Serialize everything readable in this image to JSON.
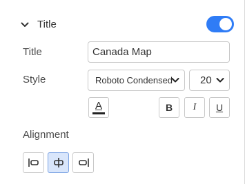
{
  "section": {
    "title": "Title",
    "enabled": true
  },
  "title_field": {
    "label": "Title",
    "value": "Canada Map"
  },
  "style": {
    "label": "Style",
    "font_family": "Roboto Condensed",
    "font_size": "20"
  },
  "format_buttons": {
    "font_color_glyph": "A",
    "bold": "B",
    "italic": "I",
    "underline": "U"
  },
  "alignment": {
    "label": "Alignment",
    "options": [
      "left",
      "center",
      "right"
    ],
    "selected": "center"
  },
  "colors": {
    "accent": "#2f7cf6",
    "selected_bg": "#d9e6fb",
    "border": "#c8c8c8"
  }
}
